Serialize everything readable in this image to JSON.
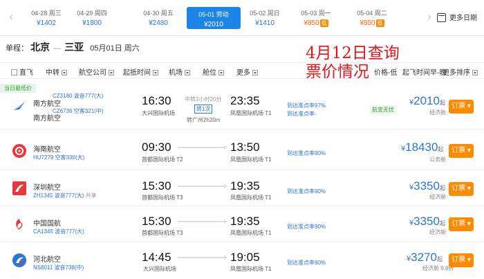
{
  "dates": [
    {
      "d": "04-28 周三",
      "p": "¥1402"
    },
    {
      "d": "04-29 周四",
      "p": "¥1800"
    },
    {
      "d": "04-30 周五",
      "p": "¥2480"
    },
    {
      "d": "05-01 劳动",
      "p": "¥2010",
      "active": true
    },
    {
      "d": "05-02 周日",
      "p": "¥1410"
    },
    {
      "d": "05-03 周一",
      "p": "¥850",
      "low": "低"
    },
    {
      "d": "05-04 周二",
      "p": "¥850",
      "low": "低"
    }
  ],
  "more_dates": "更多日期",
  "route": {
    "label": "单程：",
    "from": "北京",
    "to": "三亚",
    "arrow": "—",
    "date": "05月01日 周六"
  },
  "handwrite": [
    "4月12日查询",
    "票价情况"
  ],
  "filters": {
    "direct": "直飞",
    "transfer": "中转",
    "airline": "航空公司",
    "dep_time": "起抵时间",
    "airport": "机场",
    "cabin": "舱位",
    "more": "更多",
    "sort1": "价格-低",
    "sort2": "起飞时间早-晚",
    "sort3": "更多排序"
  },
  "today_low": "当日最低价",
  "flights": [
    {
      "airline": "南方航空",
      "fno1": "CZ3180",
      "plane1": "波音777(大)",
      "fno2": "CZ6736",
      "plane2": "空客321(中)",
      "dep": "16:30",
      "dep_ap": "大兴国际机场",
      "arr": "23:35",
      "arr_ap": "凤凰国际机场 T1",
      "transfer_time": "中转2小时20分",
      "transfer_count": "转1次",
      "transfer_city": "转广州2h20m",
      "ontime1": "到达准点率97%",
      "ontime2": "到达准点率-",
      "badge": "航变无忧",
      "price": "2010",
      "unit": "起",
      "cabin": "经济舱",
      "book": "订票"
    },
    {
      "airline": "海南航空",
      "fno1": "HU7279",
      "plane1": "空客330(大)",
      "dep": "09:30",
      "dep_ap": "首都国际机场 T2",
      "arr": "13:50",
      "arr_ap": "凤凰国际机场 T1",
      "ontime1": "到达准点率90%",
      "price": "18430",
      "unit": "起",
      "cabin": "公务舱",
      "book": "订票"
    },
    {
      "airline": "深圳航空",
      "fno1": "ZH1345",
      "plane1": "波音777(大)",
      "share": "共享",
      "dep": "15:30",
      "dep_ap": "首都国际机场 T3",
      "arr": "19:35",
      "arr_ap": "凤凰国际机场 T1",
      "ontime1": "到达准点率90%",
      "price": "3350",
      "unit": "起",
      "cabin": "经济舱",
      "book": "订票"
    },
    {
      "airline": "中国国航",
      "fno1": "CA1345",
      "plane1": "波音777(大)",
      "dep": "15:30",
      "dep_ap": "首都国际机场 T3",
      "arr": "19:35",
      "arr_ap": "凤凰国际机场 T1",
      "ontime1": "到达准点率90%",
      "price": "3350",
      "unit": "起",
      "cabin": "经济舱",
      "book": "订票"
    },
    {
      "airline": "河北航空",
      "fno1": "NS8011",
      "plane1": "波音738(中)",
      "dep": "14:45",
      "dep_ap": "大兴国际机场",
      "arr": "19:05",
      "arr_ap": "凤凰国际机场 T1",
      "ontime1": "到达准点率90%",
      "price": "3270",
      "unit": "起",
      "cabin": "经济舱 9.8折",
      "book": "订票"
    }
  ],
  "colors": {
    "brand_blue": "#1d84e8",
    "price_blue": "#2b74d8",
    "book_orange": "#ff8a00",
    "note_red": "#e0161b"
  }
}
